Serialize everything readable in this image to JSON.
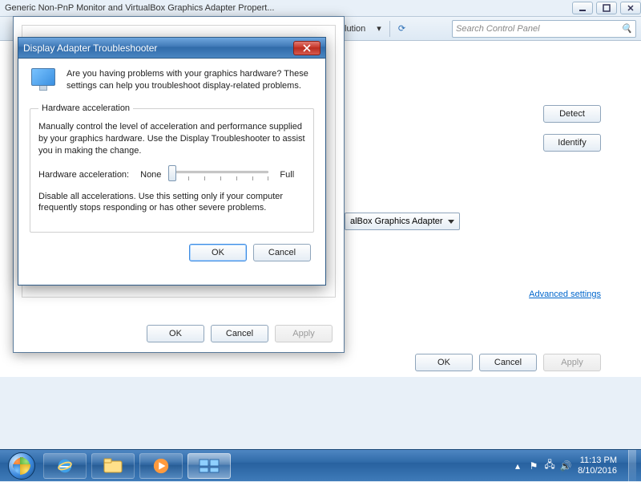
{
  "caption": {
    "title": "Generic Non-PnP Monitor and VirtualBox Graphics Adapter Propert..."
  },
  "control_panel": {
    "breadcrumb_last": "lution",
    "search_placeholder": "Search Control Panel",
    "detect": "Detect",
    "identify": "Identify",
    "adapter_label": "alBox Graphics Adapter",
    "advanced": "Advanced settings",
    "ok": "OK",
    "cancel": "Cancel",
    "apply": "Apply"
  },
  "props": {
    "ok": "OK",
    "cancel": "Cancel",
    "apply": "Apply"
  },
  "ts": {
    "title": "Display Adapter Troubleshooter",
    "intro": "Are you having problems with your graphics hardware? These settings can help you troubleshoot display-related problems.",
    "group": "Hardware acceleration",
    "group_text": "Manually control the level of acceleration and performance supplied by your graphics hardware. Use the Display Troubleshooter to assist you in making the change.",
    "slider_label": "Hardware acceleration:",
    "slider_none": "None",
    "slider_full": "Full",
    "desc": "Disable all accelerations. Use this setting only if your computer frequently stops responding or has other severe problems.",
    "ok": "OK",
    "cancel": "Cancel"
  },
  "taskbar": {
    "time": "11:13 PM",
    "date": "8/10/2016"
  }
}
